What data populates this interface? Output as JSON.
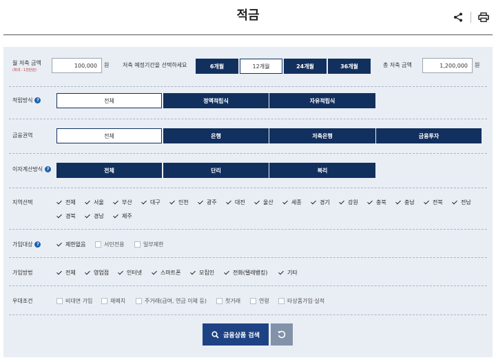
{
  "header": {
    "title": "적금"
  },
  "deposit": {
    "monthly_label": "월 저축 금액",
    "monthly_sub": "(최대 : 1천만원)",
    "monthly_value": "100,000",
    "unit": "원",
    "period_label": "저축 예정기간을 선택하세요",
    "periods": [
      "6개월",
      "12개월",
      "24개월",
      "36개월"
    ],
    "total_label": "총 저축 금액",
    "total_value": "1,200,000"
  },
  "method": {
    "label": "적립방식",
    "options": [
      "전체",
      "정액적립식",
      "자유적립식"
    ]
  },
  "sector": {
    "label": "금융권역",
    "options": [
      "전체",
      "은행",
      "저축은행",
      "금융투자"
    ]
  },
  "interest": {
    "label": "이자계산방식",
    "options": [
      "전체",
      "단리",
      "복리"
    ]
  },
  "region": {
    "label": "지역선택",
    "items": [
      "전체",
      "서울",
      "부산",
      "대구",
      "인천",
      "광주",
      "대전",
      "울산",
      "세종",
      "경기",
      "강원",
      "충북",
      "충남",
      "전북",
      "전남",
      "경북",
      "경남",
      "제주"
    ]
  },
  "target": {
    "label": "가입대상",
    "items": [
      "제한없음",
      "서민전용",
      "일부제한"
    ]
  },
  "join_method": {
    "label": "가입방법",
    "items": [
      "전체",
      "영업점",
      "인터넷",
      "스마트폰",
      "모집인",
      "전화(텔레뱅킹)",
      "기타"
    ]
  },
  "preference": {
    "label": "우대조건",
    "items": [
      "비대면 가입",
      "재예치",
      "주거래(급여, 연금 이체 등)",
      "첫거래",
      "연령",
      "타상품가입·실적"
    ]
  },
  "actions": {
    "search_label": "금융상품 검색"
  },
  "colors": {
    "navy": "#12305e",
    "panel": "#e9eef5",
    "search": "#1d4384",
    "reset": "#8292a8"
  }
}
